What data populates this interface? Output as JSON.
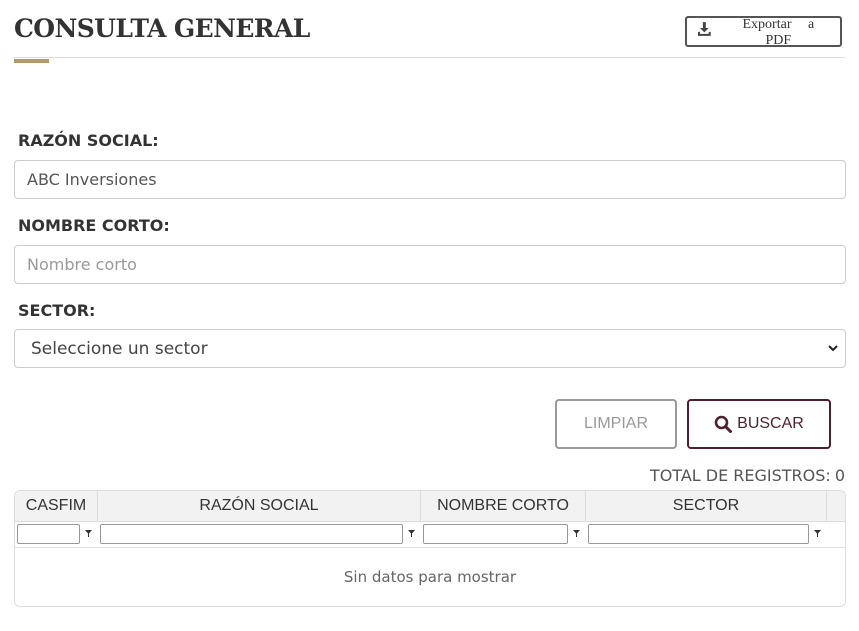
{
  "page": {
    "title": "CONSULTA GENERAL"
  },
  "export_button": {
    "label": "Exportar a PDF",
    "icon": "download-icon"
  },
  "form": {
    "razon_social": {
      "label": "RAZÓN SOCIAL:",
      "value": "ABC Inversiones"
    },
    "nombre_corto": {
      "label": "NOMBRE CORTO:",
      "placeholder": "Nombre corto"
    },
    "sector": {
      "label": "SECTOR:",
      "selected": "Seleccione un sector"
    }
  },
  "actions": {
    "clear_label": "LIMPIAR",
    "search_label": "BUSCAR"
  },
  "results": {
    "total_label": "TOTAL DE REGISTROS:",
    "total_count": "0",
    "columns": [
      "CASFIM",
      "RAZÓN SOCIAL",
      "NOMBRE CORTO",
      "SECTOR"
    ],
    "empty_message": "Sin datos para mostrar"
  },
  "colors": {
    "accent": "#b3996c",
    "primary": "#4f1f2f"
  }
}
